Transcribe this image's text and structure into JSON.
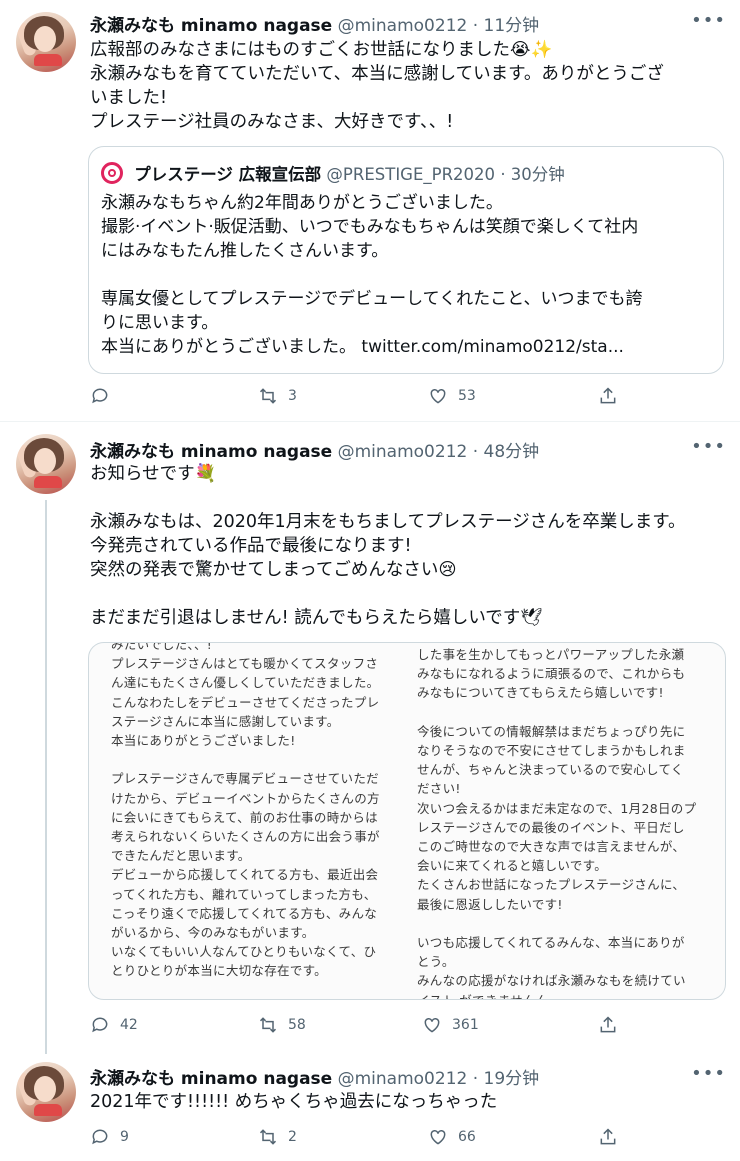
{
  "tweets": [
    {
      "name": "永瀬みなも minamo nagase",
      "handle": "@minamo0212",
      "time": "· 11分钟",
      "more": "•••",
      "text": [
        "広報部のみなさまにはものすごくお世話になりました😭✨",
        "永瀬みなもを育てていただいて、本当に感謝しています。ありがとうござ",
        "いました!",
        "プレステージ社員のみなさま、大好きです、、!"
      ],
      "quote": {
        "name": "プレステージ 広報宣伝部",
        "handle": "@PRESTIGE_PR2020",
        "time": "· 30分钟",
        "text": [
          "永瀬みなもちゃん約2年間ありがとうございました。",
          "撮影·イベント·販促活動、いつでもみなもちゃんは笑顔で楽しくて社内",
          "にはみなもたん推したくさんいます。",
          "",
          "専属女優としてプレステージでデビューしてくれたこと、いつまでも誇",
          "りに思います。",
          "本当にありがとうございました。 twitter.com/minamo0212/sta..."
        ]
      },
      "actions": {
        "reply": "",
        "retweet": "3",
        "like": "53"
      }
    },
    {
      "name": "永瀬みなも minamo nagase",
      "handle": "@minamo0212",
      "time": "· 48分钟",
      "more": "•••",
      "text": [
        "お知らせです💐",
        "",
        "永瀬みなもは、2020年1月末をもちましてプレステージさんを卒業します。",
        "今発売されている作品で最後になります!",
        "突然の発表で驚かせてしまってごめんなさい😢",
        "",
        "まだまだ引退はしません! 読んでもらえたら嬉しいです🕊"
      ],
      "image": {
        "left": [
          "みたいでした、、!",
          "プレステージさんはとても暖かくてスタッフさ",
          "ん達にもたくさん優しくしていただきました。",
          "こんなわたしをデビューさせてくださったプレ",
          "ステージさんに本当に感謝しています。",
          "本当にありがとうございました!",
          "",
          "プレステージさんで専属デビューさせていただ",
          "けたから、デビューイベントからたくさんの方",
          "に会いにきてもらえて、前のお仕事の時からは",
          "考えられないくらいたくさんの方に出会う事が",
          "できたんだと思います。",
          "デビューから応援してくれてる方も、最近出会",
          "ってくれた方も、離れていってしまった方も、",
          "こっそり遠くで応援してくれてる方も、みんな",
          "がいるから、今のみなもがいます。",
          "いなくてもいい人なんてひとりもいなくて、ひ",
          "とりひとりが本当に大切な存在です。"
        ],
        "right": [
          "した事を生かしてもっとパワーアップした永瀬",
          "みなもになれるように頑張るので、これからも",
          "みなもについてきてもらえたら嬉しいです!",
          "",
          "今後についての情報解禁はまだちょっぴり先に",
          "なりそうなので不安にさせてしまうかもしれま",
          "せんが、ちゃんと決まっているので安心してく",
          "ださい!",
          "次いつ会えるかはまだ未定なので、1月28日のプ",
          "レステージさんでの最後のイベント、平日だし",
          "このご時世なので大きな声では言えませんが、",
          "会いに来てくれると嬉しいです。",
          "たくさんお世話になったプレステージさんに、",
          "最後に恩返ししたいです!",
          "",
          "いつも応援してくれてるみんな、本当にありが",
          "とう。",
          "みんなの応援がなければ永瀬みなもを続けてい",
          "イスト ができませんん"
        ]
      },
      "actions": {
        "reply": "42",
        "retweet": "58",
        "like": "361"
      }
    },
    {
      "name": "永瀬みなも minamo nagase",
      "handle": "@minamo0212",
      "time": "· 19分钟",
      "more": "•••",
      "text": [
        "2021年です!!!!!! めちゃくちゃ過去になっちゃった"
      ],
      "actions": {
        "reply": "9",
        "retweet": "2",
        "like": "66"
      }
    }
  ],
  "colors": {
    "accent": "#1d9bf0",
    "muted": "#536471",
    "border": "#cfd9de",
    "logo": "#e0245e"
  },
  "icons": [
    "reply-icon",
    "retweet-icon",
    "like-icon",
    "share-icon",
    "more-icon"
  ]
}
